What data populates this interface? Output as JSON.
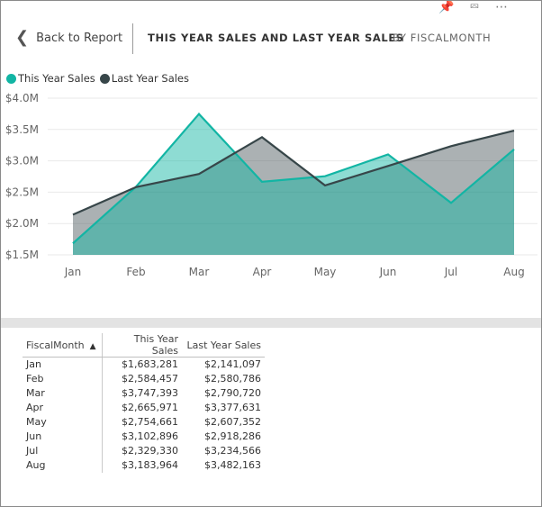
{
  "header": {
    "back_label": "Back to Report",
    "title": "THIS YEAR SALES AND LAST YEAR SALES",
    "subtitle": "BY FISCALMONTH"
  },
  "icons": [
    "pin-icon",
    "focus-mode-icon",
    "more-options-icon"
  ],
  "chart_data": {
    "type": "area",
    "categories": [
      "Jan",
      "Feb",
      "Mar",
      "Apr",
      "May",
      "Jun",
      "Jul",
      "Aug"
    ],
    "series": [
      {
        "name": "This Year Sales",
        "color": "#12b5a4",
        "values": [
          1683281,
          2584457,
          3747393,
          2665971,
          2754661,
          3102896,
          2329330,
          3183964
        ]
      },
      {
        "name": "Last Year Sales",
        "color": "#374649",
        "values": [
          2141097,
          2580786,
          2790720,
          3377631,
          2607352,
          2918286,
          3234566,
          3482163
        ]
      }
    ],
    "ylim": [
      1500000,
      4000000
    ],
    "yticks": [
      {
        "value": 4000000,
        "label": "$4.0M"
      },
      {
        "value": 3500000,
        "label": "$3.5M"
      },
      {
        "value": 3000000,
        "label": "$3.0M"
      },
      {
        "value": 2500000,
        "label": "$2.5M"
      },
      {
        "value": 2000000,
        "label": "$2.0M"
      },
      {
        "value": 1500000,
        "label": "$1.5M"
      }
    ],
    "grid": true,
    "legend_position": "top-left"
  },
  "table": {
    "columns": [
      "FiscalMonth",
      "This Year Sales",
      "Last Year Sales"
    ],
    "rows": [
      [
        "Jan",
        "$1,683,281",
        "$2,141,097"
      ],
      [
        "Feb",
        "$2,584,457",
        "$2,580,786"
      ],
      [
        "Mar",
        "$3,747,393",
        "$2,790,720"
      ],
      [
        "Apr",
        "$2,665,971",
        "$3,377,631"
      ],
      [
        "May",
        "$2,754,661",
        "$2,607,352"
      ],
      [
        "Jun",
        "$3,102,896",
        "$2,918,286"
      ],
      [
        "Jul",
        "$2,329,330",
        "$3,234,566"
      ],
      [
        "Aug",
        "$3,183,964",
        "$3,482,163"
      ]
    ]
  }
}
